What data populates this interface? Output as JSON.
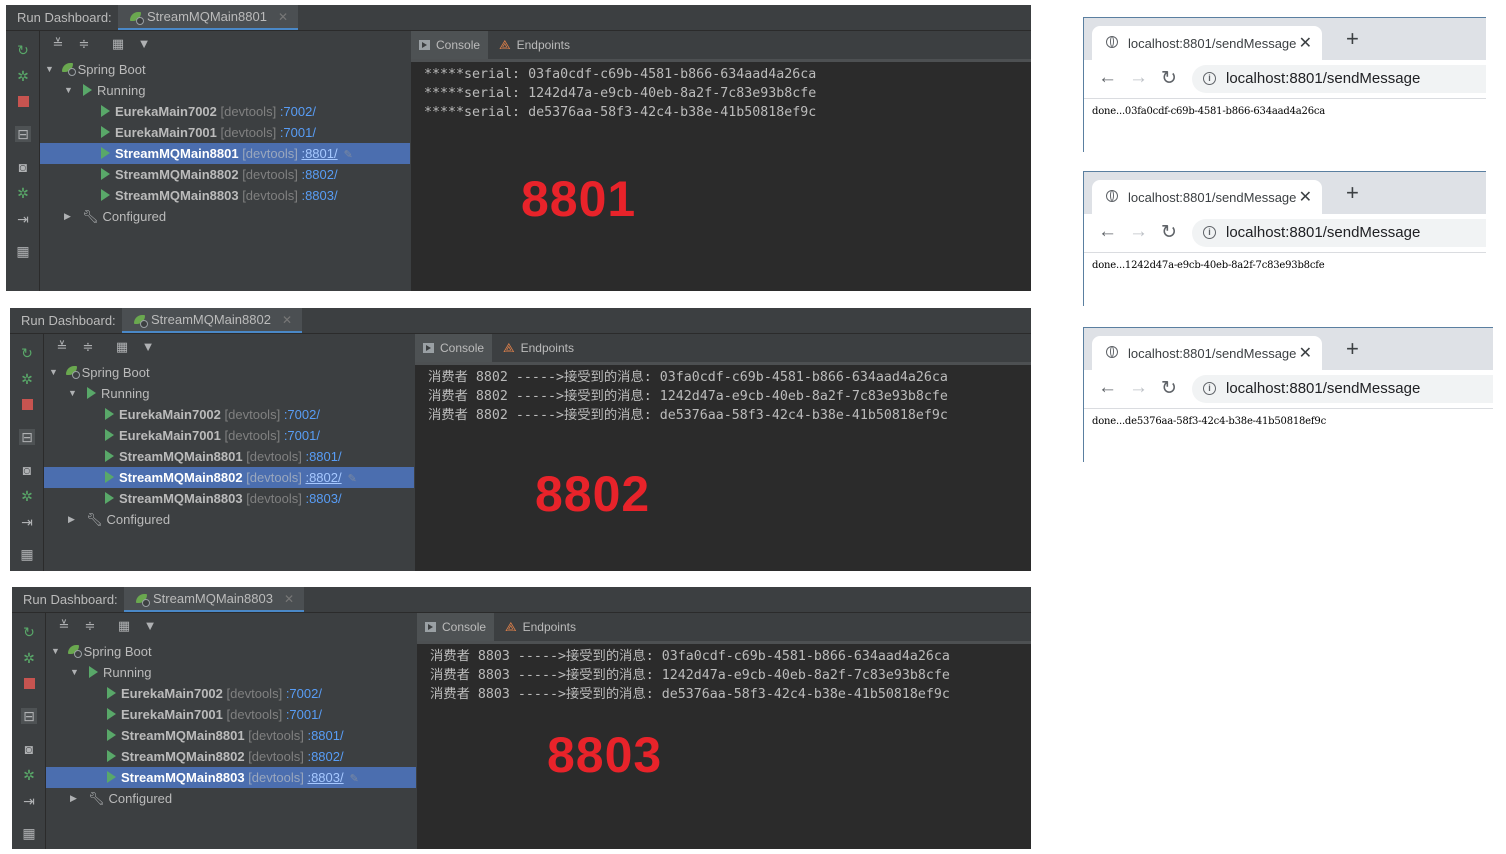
{
  "ide": {
    "run_dashboard_label": "Run Dashboard:",
    "tree": {
      "spring_boot": "Spring Boot",
      "running": "Running",
      "configured": "Configured",
      "devtools": "[devtools]",
      "apps": [
        {
          "name": "EurekaMain7002",
          "port": ":7002/"
        },
        {
          "name": "EurekaMain7001",
          "port": ":7001/"
        },
        {
          "name": "StreamMQMain8801",
          "port": ":8801/"
        },
        {
          "name": "StreamMQMain8802",
          "port": ":8802/"
        },
        {
          "name": "StreamMQMain8803",
          "port": ":8803/"
        }
      ]
    },
    "console_tab": "Console",
    "endpoints_tab": "Endpoints",
    "panels": [
      {
        "tab_title": "StreamMQMain8801",
        "selected_index": 2,
        "big_label": "8801",
        "console_lines": [
          "*****serial: 03fa0cdf-c69b-4581-b866-634aad4a26ca",
          "*****serial: 1242d47a-e9cb-40eb-8a2f-7c83e93b8cfe",
          "*****serial: de5376aa-58f3-42c4-b38e-41b50818ef9c"
        ]
      },
      {
        "tab_title": "StreamMQMain8802",
        "selected_index": 3,
        "big_label": "8802",
        "console_lines": [
          "消费者 8802 ----->接受到的消息: 03fa0cdf-c69b-4581-b866-634aad4a26ca",
          "消费者 8802 ----->接受到的消息: 1242d47a-e9cb-40eb-8a2f-7c83e93b8cfe",
          "消费者 8802 ----->接受到的消息: de5376aa-58f3-42c4-b38e-41b50818ef9c"
        ]
      },
      {
        "tab_title": "StreamMQMain8803",
        "selected_index": 4,
        "big_label": "8803",
        "console_lines": [
          "消费者 8803 ----->接受到的消息: 03fa0cdf-c69b-4581-b866-634aad4a26ca",
          "消费者 8803 ----->接受到的消息: 1242d47a-e9cb-40eb-8a2f-7c83e93b8cfe",
          "消费者 8803 ----->接受到的消息: de5376aa-58f3-42c4-b38e-41b50818ef9c"
        ]
      }
    ]
  },
  "browsers": [
    {
      "tab_title": "localhost:8801/sendMessage",
      "url": "localhost:8801/sendMessage",
      "body": "done...03fa0cdf-c69b-4581-b866-634aad4a26ca"
    },
    {
      "tab_title": "localhost:8801/sendMessage",
      "url": "localhost:8801/sendMessage",
      "body": "done...1242d47a-e9cb-40eb-8a2f-7c83e93b8cfe"
    },
    {
      "tab_title": "localhost:8801/sendMessage",
      "url": "localhost:8801/sendMessage",
      "body": "done...de5376aa-58f3-42c4-b38e-41b50818ef9c"
    }
  ],
  "colors": {
    "ide_bg": "#3c3f41",
    "console_bg": "#2b2b2b",
    "selection": "#4b6eaf",
    "run_green": "#59a869",
    "big_label_red": "#e8232a",
    "port_link": "#589df6"
  }
}
